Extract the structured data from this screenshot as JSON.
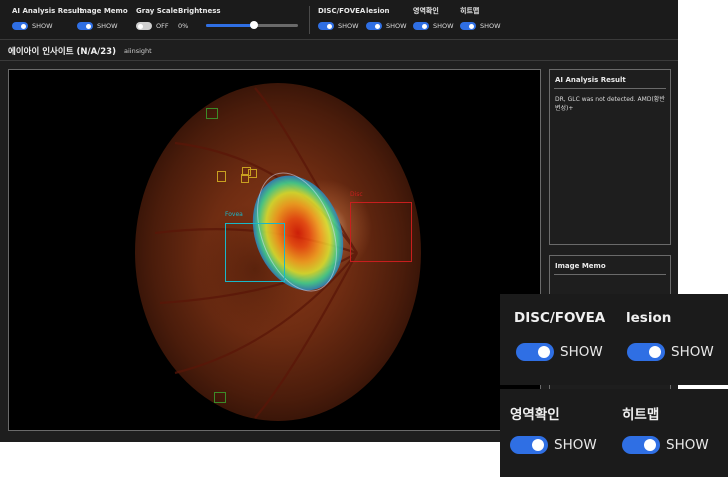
{
  "toolbar": {
    "ai_analysis": {
      "label": "AI Analysis Result",
      "state": "SHOW"
    },
    "image_memo": {
      "label": "Image Memo",
      "state": "SHOW"
    },
    "gray_scale": {
      "label": "Gray Scale",
      "state": "OFF"
    },
    "brightness": {
      "label": "Brightness",
      "value_text": "0%",
      "slider_level": 0.52
    },
    "disc_fovea": {
      "label": "DISC/FOVEA",
      "state": "SHOW"
    },
    "lesion": {
      "label": "lesion",
      "state": "SHOW"
    },
    "region_check": {
      "label": "영역확인",
      "state": "SHOW"
    },
    "heatmap": {
      "label": "히트맵",
      "state": "SHOW"
    }
  },
  "header": {
    "title": "에이아이 인사이트 (N/A/23)",
    "subtitle": "aiinsight"
  },
  "viewer": {
    "fovea_label": "Fovea",
    "disc_label": "Disc"
  },
  "ai_panel": {
    "title": "AI Analysis Result",
    "text": "DR, GLC was not detected. AMD(황반변성)+"
  },
  "memo_panel": {
    "title": "Image Memo"
  },
  "zoom_inset_top": {
    "disc_fovea": {
      "label": "DISC/FOVEA",
      "state": "SHOW"
    },
    "lesion": {
      "label": "lesion",
      "state": "SHOW"
    }
  },
  "zoom_inset_bottom": {
    "region_check": {
      "label": "영역확인",
      "state": "SHOW"
    },
    "heatmap": {
      "label": "히트맵",
      "state": "SHOW"
    }
  },
  "colors": {
    "accent": "#2f6fe4",
    "fovea_box": "#19b8c8",
    "disc_box": "#c81e1e",
    "lesion_box_yellow": "#c8a020",
    "lesion_box_green": "#3c8a28"
  }
}
